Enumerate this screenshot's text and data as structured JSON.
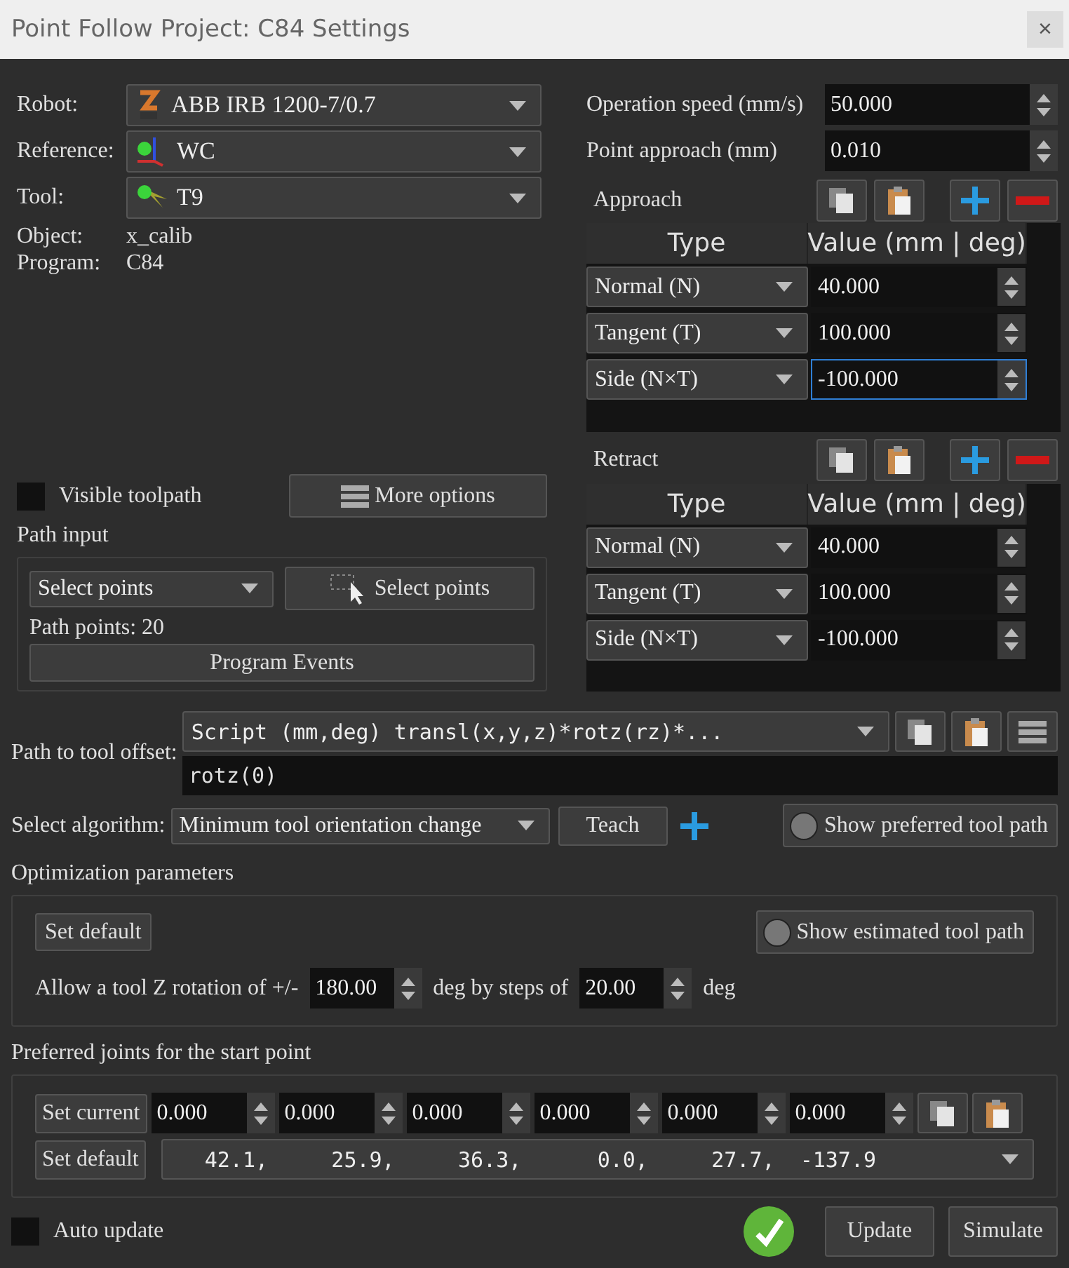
{
  "window": {
    "title": "Point Follow Project: C84 Settings",
    "close": "×"
  },
  "selectors": [
    {
      "label": "Robot:",
      "value": "ABB IRB 1200-7/0.7",
      "kind": "robot"
    },
    {
      "label": "Reference:",
      "value": "WC",
      "kind": "frame"
    },
    {
      "label": "Tool:",
      "value": "T9",
      "kind": "tool"
    }
  ],
  "info": [
    {
      "label": "Object:",
      "value": "x_calib"
    },
    {
      "label": "Program:",
      "value": "C84"
    }
  ],
  "visible_toolpath": {
    "label": "Visible toolpath",
    "checked": false
  },
  "more_options": "More options",
  "path_input": {
    "title": "Path input",
    "mode": "Select points",
    "select_button": "Select points",
    "path_points": "Path points: 20",
    "events_button": "Program Events"
  },
  "speed_fields": [
    {
      "label": "Operation speed (mm/s)",
      "value": "50.000"
    },
    {
      "label": "Point approach (mm)",
      "value": "0.010"
    }
  ],
  "motion_tables": [
    {
      "title": "Approach",
      "columns": [
        "Type",
        "Value (mm | deg)"
      ],
      "rows": [
        {
          "type": "Normal (N)",
          "value": "40.000",
          "focused": false
        },
        {
          "type": "Tangent (T)",
          "value": "100.000",
          "focused": false
        },
        {
          "type": "Side (N×T)",
          "value": "-100.000",
          "focused": true
        }
      ]
    },
    {
      "title": "Retract",
      "columns": [
        "Type",
        "Value (mm | deg)"
      ],
      "rows": [
        {
          "type": "Normal (N)",
          "value": "40.000",
          "focused": false
        },
        {
          "type": "Tangent (T)",
          "value": "100.000",
          "focused": false
        },
        {
          "type": "Side (N×T)",
          "value": "-100.000",
          "focused": false
        }
      ]
    }
  ],
  "tool_offset": {
    "label": "Path to tool offset:",
    "script": "Script (mm,deg) transl(x,y,z)*rotz(rz)*...",
    "value": "rotz(0)"
  },
  "algorithm": {
    "label": "Select algorithm:",
    "value": "Minimum tool orientation change",
    "teach": "Teach",
    "show_preferred": {
      "label": "Show preferred tool path",
      "on": false
    }
  },
  "optimization": {
    "title": "Optimization parameters",
    "set_default": "Set default",
    "show_estimated": {
      "label": "Show estimated tool path",
      "on": false
    },
    "rotation_label": "Allow a tool Z rotation of +/-",
    "rotation": "180.00",
    "steps_label": "deg by steps of",
    "steps": "20.00",
    "unit": "deg"
  },
  "preferred_joints": {
    "title": "Preferred joints for the start point",
    "set_current": "Set current",
    "joints": [
      "0.000",
      "0.000",
      "0.000",
      "0.000",
      "0.000",
      "0.000"
    ],
    "set_default": "Set default",
    "defaults": "42.1,     25.9,     36.3,      0.0,     27.7,  -137.9"
  },
  "auto_update": {
    "label": "Auto update",
    "checked": false
  },
  "buttons": [
    "Update",
    "Simulate"
  ]
}
